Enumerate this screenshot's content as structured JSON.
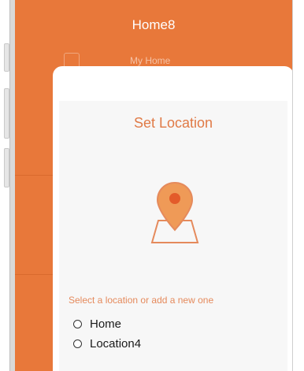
{
  "app": {
    "title": "Home8",
    "home_name": "My Home"
  },
  "modal": {
    "title": "Set Location",
    "prompt": "Select a location or add a new one",
    "options": [
      {
        "label": "Home",
        "selected": false
      },
      {
        "label": "Location4",
        "selected": false
      }
    ]
  },
  "colors": {
    "brand_orange": "#e8783a",
    "accent_text": "#e07a46"
  },
  "icons": {
    "location": "location-pin-on-map-icon"
  }
}
